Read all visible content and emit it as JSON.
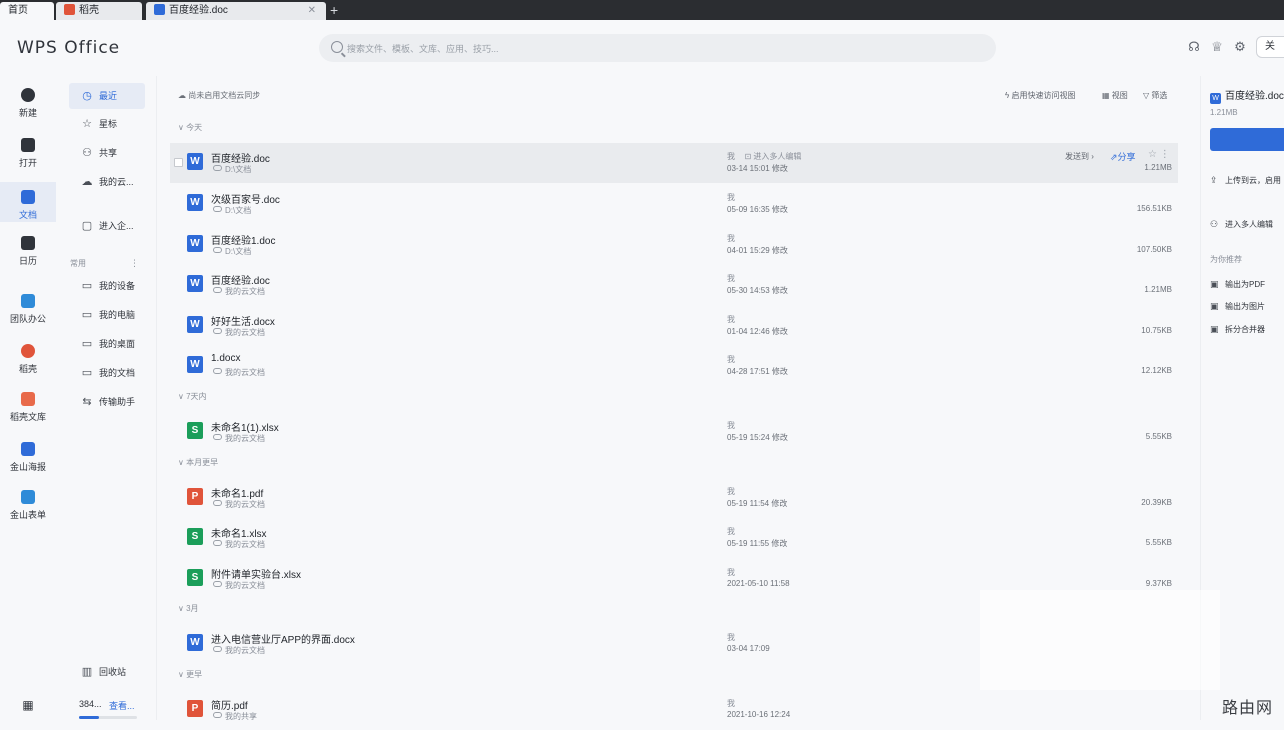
{
  "tabs": [
    {
      "label": "首页"
    },
    {
      "label": "稻壳",
      "color": "#e0543a"
    },
    {
      "label": "百度经验.doc",
      "color": "#2f6bd8"
    }
  ],
  "header": {
    "logo": "WPS Office",
    "search_placeholder": "搜索文件、模板、文库、应用、技巧...",
    "right_button": "关"
  },
  "rail": [
    {
      "label": "新建",
      "icon": "plus-circle-icon"
    },
    {
      "label": "打开",
      "icon": "folder-icon"
    },
    {
      "label": "文档",
      "icon": "document-icon",
      "active": true
    },
    {
      "label": "日历",
      "icon": "calendar-icon"
    },
    {
      "label": "团队办公",
      "icon": "team-icon"
    },
    {
      "label": "稻壳",
      "icon": "daoke-icon"
    },
    {
      "label": "稻壳文库",
      "icon": "library-icon"
    },
    {
      "label": "金山海报",
      "icon": "poster-icon"
    },
    {
      "label": "金山表单",
      "icon": "form-icon"
    }
  ],
  "nav": {
    "items": [
      {
        "label": "最近",
        "icon": "clock-icon",
        "active": true
      },
      {
        "label": "星标",
        "icon": "star-icon"
      },
      {
        "label": "共享",
        "icon": "share-icon"
      },
      {
        "label": "我的云...",
        "icon": "cloud-icon"
      },
      {
        "label": "进入企...",
        "icon": "enterprise-icon"
      }
    ],
    "section": "常用",
    "common": [
      {
        "label": "我的设备",
        "icon": "device-icon"
      },
      {
        "label": "我的电脑",
        "icon": "computer-icon"
      },
      {
        "label": "我的桌面",
        "icon": "desktop-icon"
      },
      {
        "label": "我的文档",
        "icon": "docs-folder-icon"
      },
      {
        "label": "传输助手",
        "icon": "transfer-icon"
      }
    ],
    "recycle": "回收站",
    "storage_text": "384...",
    "storage_link": "查看...",
    "storage_used": 0.35
  },
  "toolbar": {
    "sync_notice": "尚未启用文档云同步",
    "quick_view": "启用快速访问视图",
    "view": "视图",
    "filter": "筛选"
  },
  "groups": [
    {
      "label": "今天",
      "files": [
        {
          "type": "w",
          "name": "百度经验.doc",
          "location": "D:\\文档",
          "owner": "我",
          "collab": "进入多人编辑",
          "time": "03-14 15:01 修改",
          "size": "1.21MB",
          "selected": true,
          "send": "发送到",
          "share": "分享"
        }
      ]
    },
    {
      "label": "",
      "files": [
        {
          "type": "w",
          "name": "次级百家号.doc",
          "location": "D:\\文档",
          "owner": "我",
          "time": "05-09 16:35 修改",
          "size": "156.51KB"
        },
        {
          "type": "w",
          "name": "百度经验1.doc",
          "location": "D:\\文档",
          "owner": "我",
          "time": "04-01 15:29 修改",
          "size": "107.50KB"
        },
        {
          "type": "w",
          "name": "百度经验.doc",
          "location": "我的云文档",
          "owner": "我",
          "time": "05-30 14:53 修改",
          "size": "1.21MB"
        },
        {
          "type": "w",
          "name": "好好生活.docx",
          "location": "我的云文档",
          "owner": "我",
          "time": "01-04 12:46 修改",
          "size": "10.75KB"
        },
        {
          "type": "w",
          "name": "1.docx",
          "location": "我的云文档",
          "owner": "我",
          "time": "04-28 17:51 修改",
          "size": "12.12KB"
        }
      ]
    },
    {
      "label": "7天内",
      "files": [
        {
          "type": "s",
          "name": "未命名1(1).xlsx",
          "location": "我的云文档",
          "owner": "我",
          "time": "05-19 15:24 修改",
          "size": "5.55KB"
        }
      ]
    },
    {
      "label": "本月更早",
      "files": [
        {
          "type": "p",
          "name": "未命名1.pdf",
          "location": "我的云文档",
          "owner": "我",
          "time": "05-19 11:54 修改",
          "size": "20.39KB"
        },
        {
          "type": "s",
          "name": "未命名1.xlsx",
          "location": "我的云文档",
          "owner": "我",
          "time": "05-19 11:55 修改",
          "size": "5.55KB"
        },
        {
          "type": "s",
          "name": "附件请单实验台.xlsx",
          "location": "我的云文档",
          "owner": "我",
          "time": "2021-05-10 11:58",
          "size": "9.37KB"
        }
      ]
    },
    {
      "label": "3月",
      "files": [
        {
          "type": "w",
          "name": "进入电信营业厅APP的界面.docx",
          "location": "我的云文档",
          "owner": "我",
          "time": "03-04 17:09",
          "size": ""
        }
      ]
    },
    {
      "label": "更早",
      "files": [
        {
          "type": "p",
          "name": "简历.pdf",
          "location": "我的共享",
          "owner": "我",
          "time": "2021-10-16 12:24",
          "size": ""
        }
      ]
    }
  ],
  "panel": {
    "title": "百度经验.doc",
    "size": "1.21MB",
    "upload": "上传到云，启用",
    "collab": "进入多人编辑",
    "recommend": "为你推荐",
    "actions": [
      {
        "label": "输出为PDF",
        "icon": "pdf-export-icon"
      },
      {
        "label": "输出为图片",
        "icon": "image-export-icon"
      },
      {
        "label": "拆分合并器",
        "icon": "split-merge-icon"
      }
    ]
  },
  "watermark": "路由网",
  "colors": {
    "accent": "#2f6bd8",
    "word": "#2f6bd8",
    "sheet": "#1b9e5a",
    "pdf": "#e0543a"
  }
}
